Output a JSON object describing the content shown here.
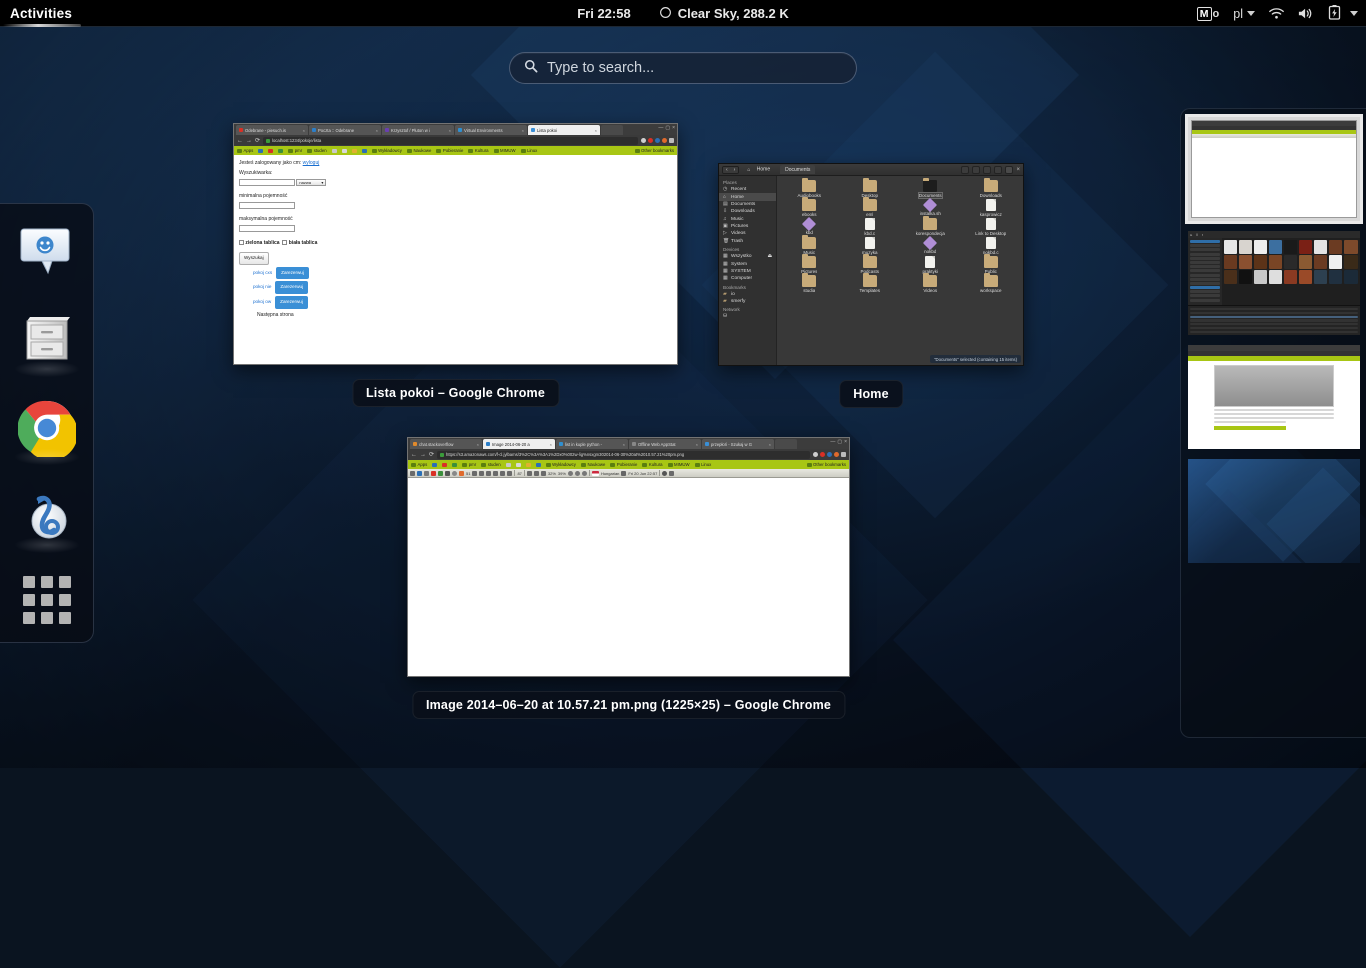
{
  "topbar": {
    "activities": "Activities",
    "clock": "Fri 22:58",
    "weather": "Clear Sky, 288.2 K",
    "weather_icon": "cloud-moon-icon",
    "mo_letter": "M",
    "mo_suffix": "o",
    "keyboard_layout": "pl",
    "icons": [
      "wifi-icon",
      "volume-icon",
      "battery-icon",
      "chevron-down-icon"
    ]
  },
  "search": {
    "placeholder": "Type to search...",
    "icon": "search-icon"
  },
  "dash": {
    "items": [
      {
        "name": "empathy",
        "label": "Empathy",
        "icon": "chat-bubble-icon",
        "running": false
      },
      {
        "name": "files",
        "label": "Files",
        "icon": "file-cabinet-icon",
        "running": true
      },
      {
        "name": "google-chrome",
        "label": "Google Chrome",
        "icon": "chrome-icon",
        "running": true
      },
      {
        "name": "banshee",
        "label": "Banshee",
        "icon": "banshee-icon",
        "running": true
      }
    ],
    "show_apps_label": "Show Applications",
    "show_apps_icon": "app-grid-icon"
  },
  "windows": [
    {
      "title": "Lista pokoi – Google Chrome",
      "type": "chrome",
      "tabs": [
        {
          "label": "Odebrane - piesuch.is",
          "active": false,
          "favcolor": "#d93025"
        },
        {
          "label": "Poczta :: Odebrane",
          "active": false,
          "favcolor": "#2c7fc9"
        },
        {
          "label": "Krzysztof / Pluton w i",
          "active": false,
          "favcolor": "#6a3fb0"
        },
        {
          "label": "Virtual Environments",
          "active": false,
          "favcolor": "#2f8fd0"
        },
        {
          "label": "Lista pokoi",
          "active": true,
          "favcolor": "#3a8fd6"
        }
      ],
      "url": "localhost:1234/pokoje/lista",
      "bookmarks": [
        "Apps",
        "pmr",
        "studen",
        "Wykładowcy",
        "Naukowe",
        "Pobieranie",
        "Kultura",
        "MIMUW",
        "Linux"
      ],
      "other_bookmarks": "Other bookmarks",
      "page": {
        "logged_line": "Jesteś zalogowany jako cm:",
        "logout_link": "wyloguj",
        "label_search": "Wyszukiwarka:",
        "select_value": "nazwa",
        "label_min": "minimalna pojemność",
        "label_max": "maksymalna pojemność",
        "check1": "zielona tablica",
        "check2": "biała tablica",
        "button_search": "Wyszukaj",
        "rows": [
          {
            "link": "pokoj cxs",
            "action": "Zarezerwuj"
          },
          {
            "link": "pokoj nie",
            "action": "Zarezerwuj"
          },
          {
            "link": "pokoj ow",
            "action": "Zarezerwuj"
          }
        ],
        "next_page": "Następna strona"
      }
    },
    {
      "title": "Home",
      "type": "nautilus",
      "breadcrumb": [
        "Home",
        "Documents"
      ],
      "sidebar": {
        "groups": [
          {
            "label": "Places",
            "items": [
              "Recent",
              "Home",
              "Documents",
              "Downloads",
              "Music",
              "Pictures",
              "Videos",
              "Trash"
            ],
            "selected": "Home"
          },
          {
            "label": "Devices",
            "items": [
              "Wszystko",
              "System",
              "SYSTEM",
              "Computer"
            ]
          },
          {
            "label": "Bookmarks",
            "items": [
              "io",
              "smerfy"
            ]
          },
          {
            "label": "Network",
            "items": []
          }
        ]
      },
      "files": [
        {
          "name": "Audiobooks",
          "icon": "folder"
        },
        {
          "name": "Desktop",
          "icon": "folder"
        },
        {
          "name": "Documents",
          "icon": "folder-dark",
          "selected": true
        },
        {
          "name": "Downloads",
          "icon": "folder"
        },
        {
          "name": "ebooks",
          "icon": "folder"
        },
        {
          "name": "eml",
          "icon": "folder"
        },
        {
          "name": "instalka.sh",
          "icon": "gem"
        },
        {
          "name": "kasprowicz",
          "icon": "doc"
        },
        {
          "name": "kbd",
          "icon": "gem"
        },
        {
          "name": "kbd.c",
          "icon": "doc"
        },
        {
          "name": "korespondecja",
          "icon": "folder"
        },
        {
          "name": "Link to Desktop",
          "icon": "doc"
        },
        {
          "name": "Music",
          "icon": "folder"
        },
        {
          "name": "muzyka",
          "icon": "doc"
        },
        {
          "name": "nokbd",
          "icon": "gem"
        },
        {
          "name": "nokbd.c",
          "icon": "doc"
        },
        {
          "name": "Pictures",
          "icon": "folder"
        },
        {
          "name": "Podcasts",
          "icon": "folder"
        },
        {
          "name": "praktyki",
          "icon": "doc"
        },
        {
          "name": "Public",
          "icon": "folder"
        },
        {
          "name": "studia",
          "icon": "folder"
        },
        {
          "name": "Templates",
          "icon": "folder"
        },
        {
          "name": "Videos",
          "icon": "folder"
        },
        {
          "name": "workspace",
          "icon": "folder"
        }
      ],
      "status": "\"Documents\" selected (containing 15 items)"
    },
    {
      "title": "Image 2014–06–20 at 10.57.21 pm.png (1225×25) – Google Chrome",
      "type": "chrome-image",
      "tabs": [
        {
          "label": "chat.stackoverflow",
          "active": false,
          "favcolor": "#e08a2c"
        },
        {
          "label": "Image 2014-06-20 a",
          "active": true,
          "favcolor": "#2c7fc9"
        },
        {
          "label": "list in kuple python -",
          "active": false,
          "favcolor": "#2f8fd0"
        },
        {
          "label": "Offline Web AppStat",
          "active": false,
          "favcolor": "#888888"
        },
        {
          "label": "przepłoń - Szukaj w G",
          "active": false,
          "favcolor": "#3a8fd6"
        }
      ],
      "url": "https://s3.amazonaws.com/f-cl.jylbams/3%2C%3A%3A1%2Dx0%002w-lig%nsxgm302014-06-30%20at%2010.57.21%20pm.png",
      "bookmarks": [
        "Apps",
        "pmr",
        "studen",
        "Wykładowcy",
        "Naukowe",
        "Pobieranie",
        "Kultura",
        "MIMUW",
        "Linux"
      ],
      "other_bookmarks": "Other bookmarks",
      "toolbar_right": [
        "Hungarian",
        "Fri 20 Jun 22:57"
      ]
    }
  ],
  "workspaces": [
    {
      "name": "workspace-1",
      "kind": "browser",
      "active": true
    },
    {
      "name": "workspace-2",
      "kind": "banshee",
      "active": false
    },
    {
      "name": "workspace-3",
      "kind": "webpage",
      "active": false
    },
    {
      "name": "workspace-4",
      "kind": "empty",
      "active": false
    }
  ],
  "colors": {
    "topbar_bg": "#000000",
    "accent_blue": "#3a8fd6",
    "bookmark_bar": "#a8c614",
    "desktop_dark": "#0a1420"
  }
}
